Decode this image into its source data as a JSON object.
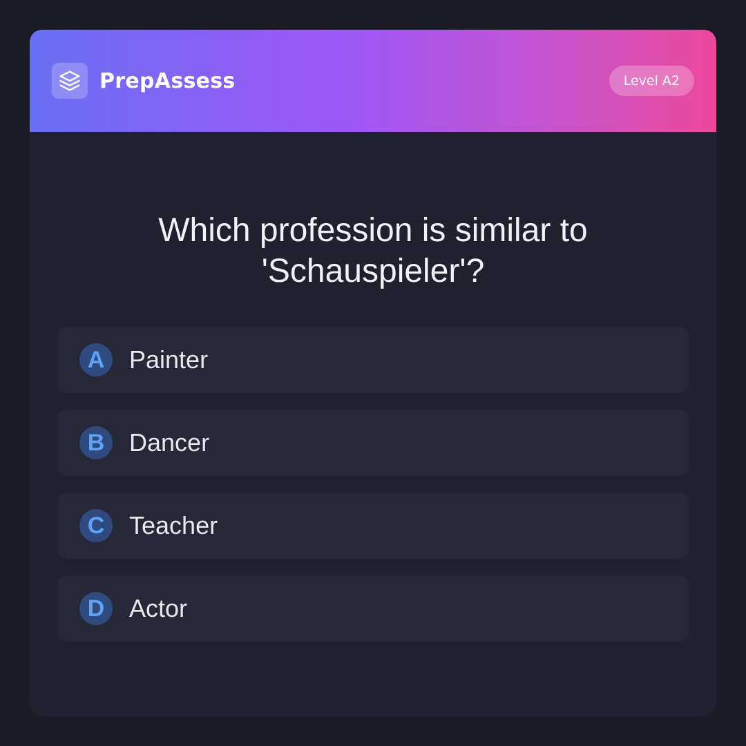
{
  "app": {
    "name": "PrepAssess",
    "logo_icon": "layers-icon",
    "level_badge": "Level A2"
  },
  "colors": {
    "gradient_start": "#6a6ff4",
    "gradient_mid": "#a157f5",
    "gradient_end": "#ec4899",
    "card_bg": "#1f212e",
    "option_bg": "#262837",
    "letter_accent": "#5ea2f6"
  },
  "quiz": {
    "question": "Which profession is similar to 'Schauspieler'?",
    "options": [
      {
        "letter": "A",
        "text": "Painter"
      },
      {
        "letter": "B",
        "text": "Dancer"
      },
      {
        "letter": "C",
        "text": "Teacher"
      },
      {
        "letter": "D",
        "text": "Actor"
      }
    ]
  }
}
